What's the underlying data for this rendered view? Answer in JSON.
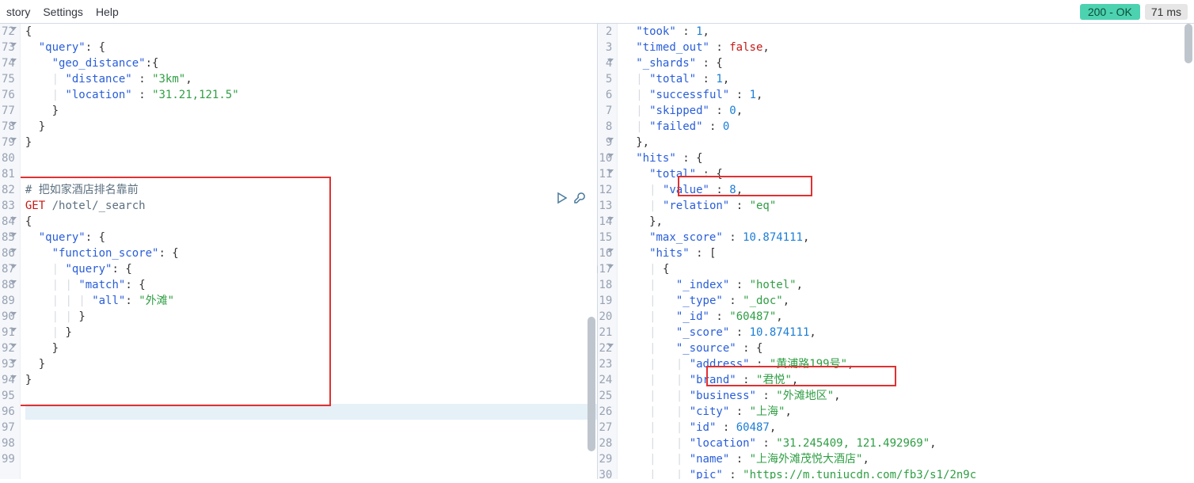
{
  "menu": {
    "history": "story",
    "settings": "Settings",
    "help": "Help"
  },
  "status": {
    "code": "200 - OK",
    "time": "71 ms"
  },
  "left": {
    "gutter": [
      "72",
      "73",
      "74",
      "75",
      "76",
      "77",
      "78",
      "79",
      "80",
      "81",
      "82",
      "83",
      "84",
      "85",
      "86",
      "87",
      "88",
      "89",
      "90",
      "91",
      "92",
      "93",
      "94",
      "95",
      "96",
      "97",
      "98",
      "99"
    ]
  },
  "right": {
    "gutter": [
      "2",
      "3",
      "4",
      "5",
      "6",
      "7",
      "8",
      "9",
      "10",
      "11",
      "12",
      "13",
      "14",
      "15",
      "16",
      "17",
      "18",
      "19",
      "20",
      "21",
      "22",
      "23",
      "24",
      "25",
      "26",
      "27",
      "28",
      "29",
      "30"
    ]
  },
  "req": {
    "q": "\"query\"",
    "geo": "\"geo_distance\"",
    "dist": "\"distance\"",
    "km": "\"3km\"",
    "loc": "\"location\"",
    "locv": "\"31.21,121.5\"",
    "cmt": "# 把如家酒店排名靠前",
    "method": "GET",
    "path": "/hotel/_search",
    "fs": "\"function_score\"",
    "match": "\"match\"",
    "all": "\"all\"",
    "wt": "\"外滩\""
  },
  "res": {
    "took": "\"took\"",
    "tookv": "1",
    "timed": "\"timed_out\"",
    "false": "false",
    "shards": "\"_shards\"",
    "total": "\"total\"",
    "n1": "1",
    "succ": "\"successful\"",
    "skip": "\"skipped\"",
    "n0": "0",
    "fail": "\"failed\"",
    "hits": "\"hits\"",
    "value": "\"value\"",
    "n8": "8",
    "rel": "\"relation\"",
    "eq": "\"eq\"",
    "max": "\"max_score\"",
    "score": "10.874111",
    "idx": "\"_index\"",
    "hotel": "\"hotel\"",
    "type": "\"_type\"",
    "doc": "\"_doc\"",
    "id": "\"_id\"",
    "idv": "\"60487\"",
    "scorek": "\"_score\"",
    "src": "\"_source\"",
    "addr": "\"address\"",
    "addrv": "\"黄浦路199号\"",
    "brand": "\"brand\"",
    "brandv": "\"君悦\"",
    "biz": "\"business\"",
    "bizv": "\"外滩地区\"",
    "city": "\"city\"",
    "cityv": "\"上海\"",
    "idk": "\"id\"",
    "idn": "60487",
    "lock": "\"location\"",
    "locv": "\"31.245409, 121.492969\"",
    "name": "\"name\"",
    "namev": "\"上海外滩茂悦大酒店\"",
    "pic": "\"pic\"",
    "picv": "\"https://m.tuniucdn.com/fb3/s1/2n9c"
  }
}
